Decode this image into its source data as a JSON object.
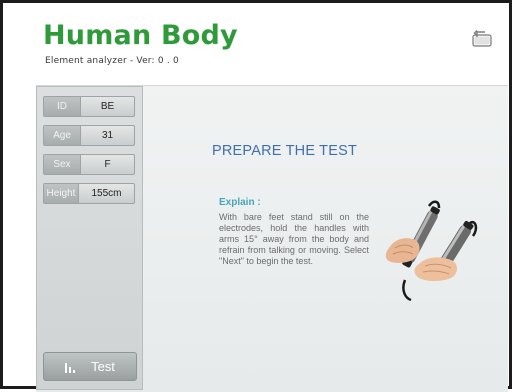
{
  "app": {
    "title": "Human Body",
    "subtitle": "Element analyzer - Ver:  0 . 0"
  },
  "sidebar": {
    "fields": [
      {
        "label": "ID",
        "value": "BE"
      },
      {
        "label": "Age",
        "value": "31"
      },
      {
        "label": "Sex",
        "value": "F"
      },
      {
        "label": "Height",
        "value": "155cm"
      }
    ],
    "test_button": {
      "label": "Test",
      "icon": "bar-chart-icon"
    }
  },
  "main": {
    "heading": "PREPARE THE TEST",
    "explain_title": "Explain :",
    "explain_text": "With bare feet stand still on the electrodes, hold the handles with arms 15° away from the body and refrain from talking or moving.  Select \"Next\" to begin the test."
  },
  "icons": {
    "back": "back-icon",
    "illustration": "hands-holding-electrode-handles"
  },
  "colors": {
    "title_green": "#2f9a3a",
    "heading_blue": "#3f6fae",
    "explain_teal": "#46a6b8"
  }
}
